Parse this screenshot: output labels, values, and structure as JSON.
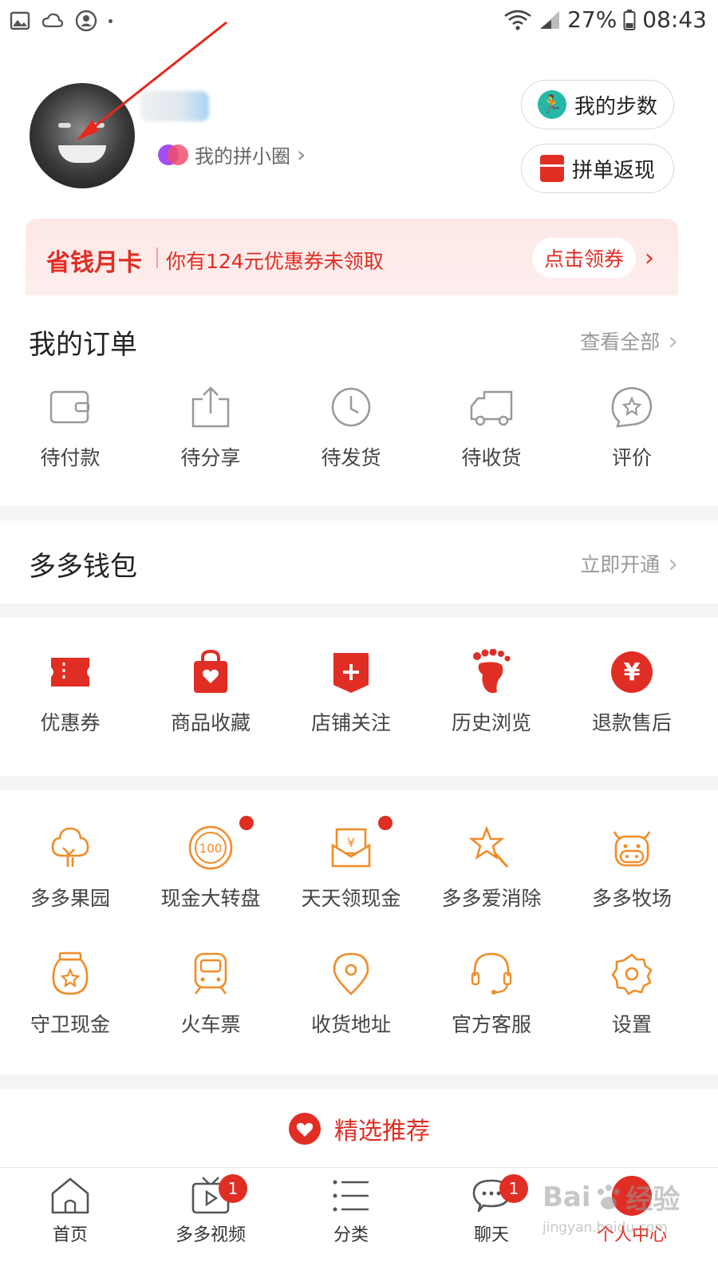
{
  "status_bar": {
    "battery": "27%",
    "time": "08:43"
  },
  "profile": {
    "circle_link": "我的拼小圈",
    "steps_button": "我的步数",
    "cashback_button": "拼单返现"
  },
  "banner": {
    "title": "省钱月卡",
    "text": "你有124元优惠券未领取",
    "button": "点击领券"
  },
  "orders": {
    "title": "我的订单",
    "view_all": "查看全部",
    "items": [
      "待付款",
      "待分享",
      "待发货",
      "待收货",
      "评价"
    ]
  },
  "wallet": {
    "title": "多多钱包",
    "action": "立即开通"
  },
  "services": {
    "items": [
      "优惠券",
      "商品收藏",
      "店铺关注",
      "历史浏览",
      "退款售后"
    ],
    "refund_symbol": "¥"
  },
  "features": {
    "row1": [
      "多多果园",
      "现金大转盘",
      "天天领现金",
      "多多爱消除",
      "多多牧场"
    ],
    "row2": [
      "守卫现金",
      "火车票",
      "收货地址",
      "官方客服",
      "设置"
    ],
    "wheel_text": "100",
    "cash_symbol": "¥"
  },
  "recommend": {
    "label": "精选推荐"
  },
  "tabbar": {
    "home": "首页",
    "video": "多多视频",
    "video_badge": "1",
    "category": "分类",
    "chat": "聊天",
    "chat_badge": "1",
    "me": "个人中心"
  },
  "watermark": {
    "brand": "Bai",
    "brand2": "经验",
    "url": "jingyan.baidu.com"
  },
  "colors": {
    "accent": "#e02e24",
    "orange_icon": "#f08c28",
    "teal": "#27b7a6"
  }
}
